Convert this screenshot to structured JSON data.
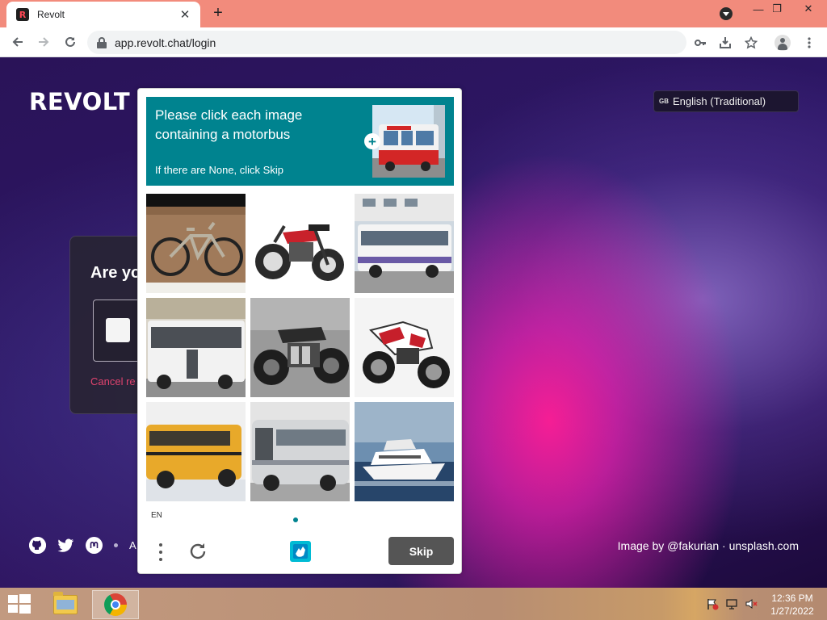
{
  "browser": {
    "tab": {
      "favicon_letter": "R",
      "title": "Revolt",
      "close_glyph": "✕"
    },
    "new_tab_glyph": "+",
    "window": {
      "minimize": "—",
      "restore": "❐",
      "close": "✕"
    },
    "url": "app.revolt.chat/login",
    "toolbar_icons": [
      "back-icon",
      "forward-icon",
      "reload-icon",
      "lock-icon",
      "key-icon",
      "install-icon",
      "star-icon",
      "profile-icon",
      "menu-icon"
    ]
  },
  "page": {
    "brand": "REVOLT",
    "language": {
      "flag": "GB",
      "label": "English (Traditional)"
    },
    "card": {
      "heading": "Are yo",
      "cancel_link": "Cancel re"
    },
    "footer": {
      "text_partial": "A",
      "icons": [
        "github-icon",
        "twitter-icon",
        "mastodon-icon"
      ]
    },
    "credit": "Image by @fakurian · unsplash.com"
  },
  "captcha": {
    "prompt": "Please click each image containing a motorbus",
    "hint": "If there are None, click Skip",
    "language": "EN",
    "skip_label": "Skip",
    "accent": "#00838f",
    "images": [
      {
        "subject": "bicycle"
      },
      {
        "subject": "motorcycle"
      },
      {
        "subject": "bus"
      },
      {
        "subject": "bus"
      },
      {
        "subject": "motorcycle"
      },
      {
        "subject": "motorcycle"
      },
      {
        "subject": "school bus"
      },
      {
        "subject": "bus"
      },
      {
        "subject": "boat"
      }
    ]
  },
  "taskbar": {
    "time": "12:36 PM",
    "date": "1/27/2022",
    "apps": [
      "file-explorer-icon",
      "chrome-icon"
    ]
  }
}
